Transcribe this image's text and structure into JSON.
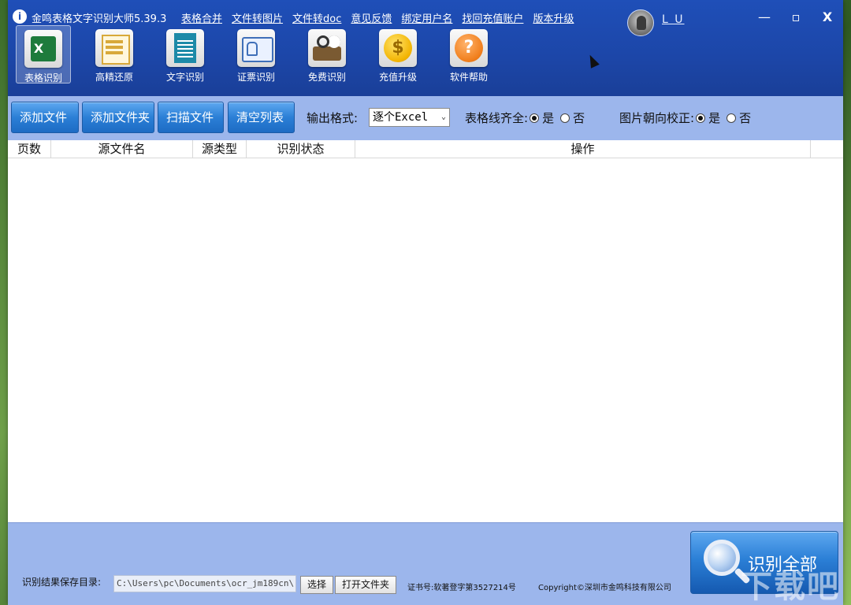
{
  "app": {
    "logo_glyph": "i",
    "title": "金鸣表格文字识别大师5.39.3"
  },
  "top_links": [
    {
      "label": "表格合并"
    },
    {
      "label": "文件转图片"
    },
    {
      "label": "文件转doc"
    },
    {
      "label": "意见反馈"
    },
    {
      "label": "绑定用户名"
    },
    {
      "label": "找回充值账户"
    },
    {
      "label": "版本升级"
    }
  ],
  "user": {
    "name": "L U"
  },
  "window_controls": {
    "minimize": "—",
    "maximize": "▫",
    "close": "X"
  },
  "toolbar": [
    {
      "label": "表格识别",
      "icon": "excel-icon",
      "active": true
    },
    {
      "label": "高精还原",
      "icon": "restore-doc-icon"
    },
    {
      "label": "文字识别",
      "icon": "text-doc-icon"
    },
    {
      "label": "证票识别",
      "icon": "id-card-icon"
    },
    {
      "label": "免费识别",
      "icon": "book-glasses-icon"
    },
    {
      "label": "充值升级",
      "icon": "coin-icon"
    },
    {
      "label": "软件帮助",
      "icon": "help-icon"
    }
  ],
  "actions": {
    "add_file": "添加文件",
    "add_folder": "添加文件夹",
    "scan_file": "扫描文件",
    "clear_list": "清空列表"
  },
  "options": {
    "output_format_label": "输出格式:",
    "output_format_value": "逐个Excel",
    "table_lines_label": "表格线齐全:",
    "table_lines_yes": "是",
    "table_lines_no": "否",
    "table_lines_selected": "yes",
    "orientation_label": "图片朝向校正:",
    "orientation_yes": "是",
    "orientation_no": "否",
    "orientation_selected": "yes"
  },
  "table": {
    "columns": [
      "页数",
      "源文件名",
      "源类型",
      "识别状态",
      "操作"
    ],
    "rows": []
  },
  "footer": {
    "save_dir_label": "识别结果保存目录:",
    "save_dir_value": "C:\\Users\\pc\\Documents\\ocr_jm189cn\\",
    "choose_button": "选择",
    "open_folder_button": "打开文件夹",
    "cert": "证书号:软著登字第3527214号",
    "copyright": "Copyright©深圳市金鸣科技有限公司",
    "recognize_all": "识别全部"
  },
  "watermark": "下载吧"
}
